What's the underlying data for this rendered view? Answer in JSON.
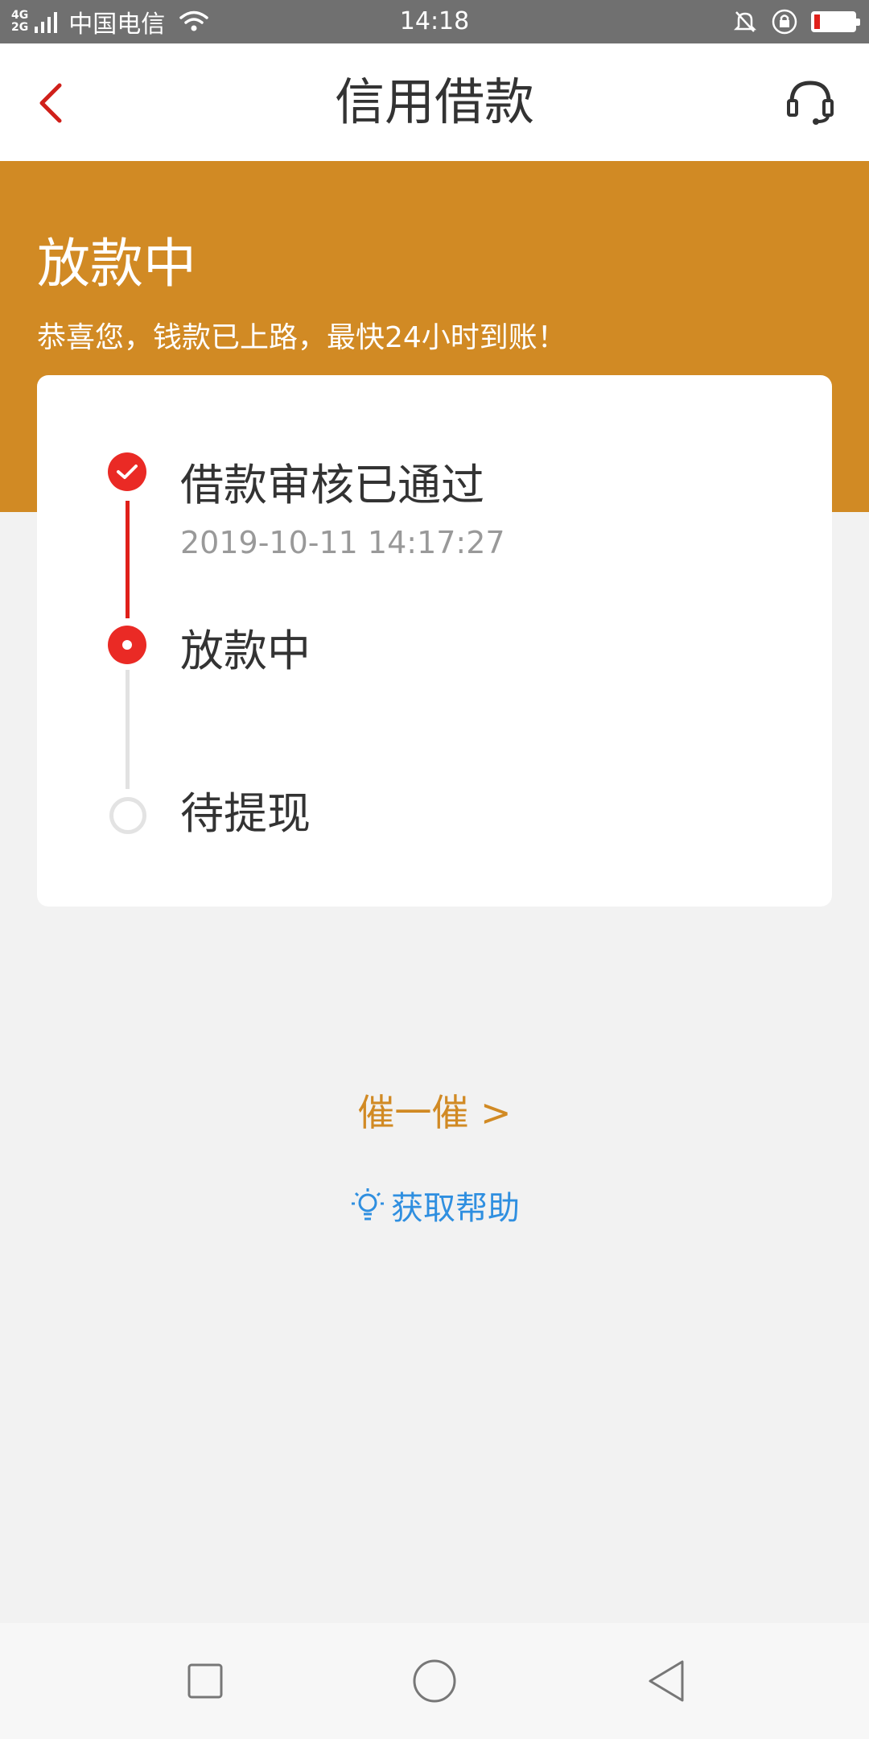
{
  "status_bar": {
    "net_top": "4G",
    "net_bottom": "2G",
    "carrier": "中国电信",
    "time": "14:18",
    "battery_level": 0.15
  },
  "header": {
    "title": "信用借款",
    "back_icon": "chevron-left-icon",
    "service_icon": "headset-icon"
  },
  "banner": {
    "title": "放款中",
    "subtitle": "恭喜您，钱款已上路，最快24小时到账！",
    "color": "#d18a24"
  },
  "steps": [
    {
      "label": "借款审核已通过",
      "time": "2019-10-11 14:17:27",
      "state": "done"
    },
    {
      "label": "放款中",
      "state": "current"
    },
    {
      "label": "待提现",
      "state": "pending"
    }
  ],
  "actions": {
    "urge_label": "催一催 >",
    "help_label": "获取帮助"
  },
  "colors": {
    "accent_red": "#e0201a",
    "accent_orange": "#d18a24",
    "link_blue": "#2f8fe0"
  }
}
